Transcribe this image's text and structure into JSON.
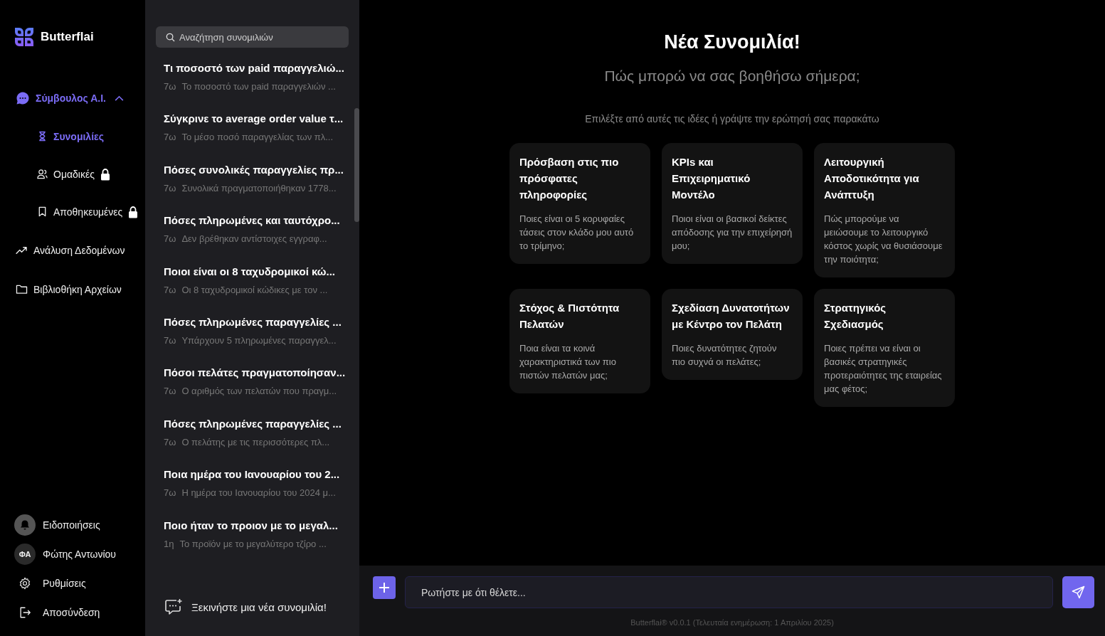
{
  "brand": {
    "name": "Butterflai"
  },
  "nav": [
    {
      "label": "Σύμβουλος Α.Ι.",
      "kind": "chat",
      "selected": true,
      "expanded": true,
      "children": [
        {
          "label": "Συνομιλίες",
          "kind": "hourglass",
          "selected": true,
          "locked": false
        },
        {
          "label": "Ομαδικές",
          "kind": "users",
          "selected": false,
          "locked": true
        },
        {
          "label": "Αποθηκευμένες",
          "kind": "bookmark",
          "selected": false,
          "locked": true
        }
      ]
    },
    {
      "label": "Ανάλυση Δεδομένων",
      "kind": "trend",
      "selected": false
    },
    {
      "label": "Βιβλιοθήκη Αρχείων",
      "kind": "folder",
      "selected": false
    }
  ],
  "account": [
    {
      "label": "Ειδοποιήσεις",
      "kind": "bell"
    },
    {
      "label": "Φώτης Αντωνίου",
      "kind": "avatar",
      "initials": "ΦΑ"
    },
    {
      "label": "Ρυθμίσεις",
      "kind": "gear"
    },
    {
      "label": "Αποσύνδεση",
      "kind": "logout"
    }
  ],
  "search": {
    "placeholder": "Αναζήτηση συνομιλιών"
  },
  "conversations": [
    {
      "title": "Τι ποσοστό των paid παραγγελιώ...",
      "age": "7ω",
      "preview": "Το ποσοστό των paid παραγγελιών ..."
    },
    {
      "title": "Σύγκρινε το average order value τ...",
      "age": "7ω",
      "preview": "Το μέσο ποσό παραγγελίας των πλ..."
    },
    {
      "title": "Πόσες συνολικές παραγγελίες πρ...",
      "age": "7ω",
      "preview": "Συνολικά πραγματοποιήθηκαν 1778..."
    },
    {
      "title": "Πόσες πληρωμένες και ταυτόχρο...",
      "age": "7ω",
      "preview": "Δεν βρέθηκαν αντίστοιχες εγγραφ..."
    },
    {
      "title": "Ποιοι είναι οι 8 ταχυδρομικοί κώ...",
      "age": "7ω",
      "preview": "Οι 8 ταχυδρομικοί κώδικες με τον ..."
    },
    {
      "title": "Πόσες πληρωμένες παραγγελίες ...",
      "age": "7ω",
      "preview": "Υπάρχουν 5 πληρωμένες παραγγελ..."
    },
    {
      "title": "Πόσοι πελάτες πραγματοποίησαν...",
      "age": "7ω",
      "preview": "Ο αριθμός των πελατών που πραγμ..."
    },
    {
      "title": "Πόσες πληρωμένες παραγγελίες ...",
      "age": "7ω",
      "preview": "Ο πελάτης με τις περισσότερες πλ..."
    },
    {
      "title": "Ποια ημέρα του Ιανουαρίου του 2...",
      "age": "7ω",
      "preview": "Η ημέρα του Ιανουαρίου του 2024 μ..."
    },
    {
      "title": "Ποιο ήταν το προιον με το μεγαλ...",
      "age": "1η",
      "preview": "Το προϊόν με το μεγαλύτερο τζίρο ..."
    }
  ],
  "new_chat": {
    "label": "Ξεκινήστε μια νέα συνομιλία!"
  },
  "welcome": {
    "title": "Νέα Συνομιλία!",
    "subtitle": "Πώς μπορώ να σας βοηθήσω σήμερα;",
    "hint": "Επιλέξτε από αυτές τις ιδέες ή γράψτε την ερώτησή σας παρακάτω"
  },
  "suggestions": [
    {
      "title": "Πρόσβαση στις πιο πρόσφατες πληροφορίες",
      "question": "Ποιες είναι οι 5 κορυφαίες τάσεις στον κλάδο μου αυτό το τρίμηνο;"
    },
    {
      "title": "KPIs και Επιχειρηματικό Μοντέλο",
      "question": "Ποιοι είναι οι βασικοί δείκτες απόδοσης για την επιχείρησή μου;"
    },
    {
      "title": "Λειτουργική Αποδοτικότητα για Ανάπτυξη",
      "question": "Πώς μπορούμε να μειώσουμε το λειτουργικό κόστος χωρίς να θυσιάσουμε την ποιότητα;"
    },
    {
      "title": "Στόχος & Πιστότητα Πελατών",
      "question": "Ποια είναι τα κοινά χαρακτηριστικά των πιο πιστών πελατών μας;"
    },
    {
      "title": "Σχεδίαση Δυνατοτήτων με Κέντρο τον Πελάτη",
      "question": "Ποιες δυνατότητες ζητούν πιο συχνά οι πελάτες;"
    },
    {
      "title": "Στρατηγικός Σχεδιασμός",
      "question": "Ποιες πρέπει να είναι οι βασικές στρατηγικές προτεραιότητες της εταιρείας μας φέτος;"
    }
  ],
  "composer": {
    "placeholder": "Ρωτήστε με ότι θέλετε..."
  },
  "footer": "Butterflai® v0.0.1 (Τελευταία ενημέρωση: 1 Απριλίου 2025)"
}
